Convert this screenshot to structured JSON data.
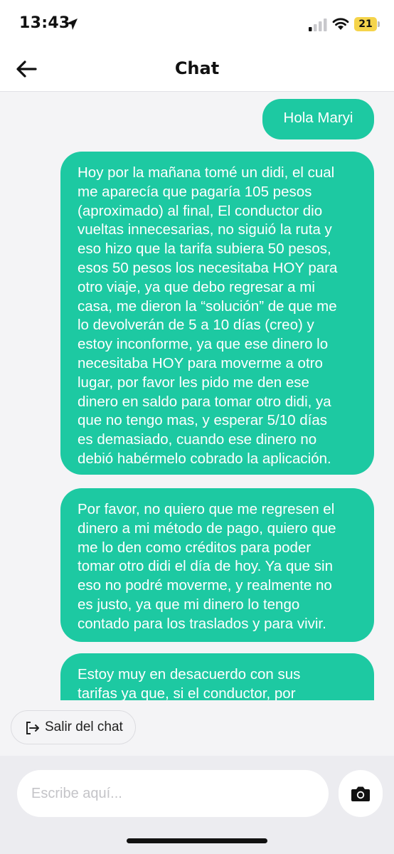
{
  "status_bar": {
    "time": "13:43",
    "battery": "21"
  },
  "header": {
    "title": "Chat"
  },
  "messages": [
    {
      "text": "Hola Maryi"
    },
    {
      "text": "Hoy por la mañana tomé un didi, el cual\nme aparecía que pagaría 105 pesos\n(aproximado) al final, El conductor dio\nvueltas innecesarias, no siguió la ruta y\neso hizo que la tarifa subiera 50 pesos,\nesos 50 pesos los necesitaba HOY para\notro viaje, ya que debo regresar a mi\ncasa, me dieron la “solución” de que me\nlo devolverán de 5 a 10 días (creo) y\nestoy inconforme, ya que ese dinero lo\nnecesitaba HOY para moverme a otro\nlugar, por favor les pido me den ese\ndinero en saldo para tomar otro didi, ya\nque no tengo mas, y esperar 5/10 días\nes demasiado, cuando ese dinero no\ndebió habérmelo cobrado la aplicación."
    },
    {
      "text": "Por favor, no quiero que me regresen el\ndinero a mi método de pago, quiero que\nme lo den como créditos para poder\ntomar otro didi el día de hoy. Ya que sin\neso no podré moverme, y realmente no\nes justo, ya que mi dinero lo tengo\ncontado para los traslados y para vivir."
    },
    {
      "text": "Estoy muy en desacuerdo con sus\ntarifas ya que, si el conductor, por"
    }
  ],
  "exit_chat": {
    "label": "Salir del chat"
  },
  "composer": {
    "placeholder": "Escribe aquí..."
  },
  "colors": {
    "bubble": "#1dc9a2",
    "background": "#f4f4f6",
    "battery": "#f5d44b"
  },
  "icons": {
    "back": "arrow-left-icon",
    "exit": "exit-icon",
    "camera": "camera-icon",
    "location": "location-arrow-icon",
    "signal": "cellular-signal-icon",
    "wifi": "wifi-icon"
  }
}
